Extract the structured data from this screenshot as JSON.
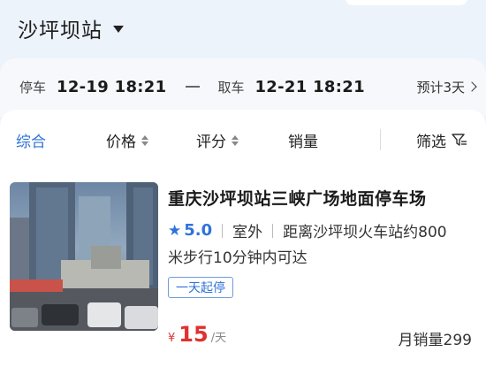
{
  "location": {
    "title": "沙坪坝站"
  },
  "time": {
    "park_label": "停车",
    "park_value": "12-19 18:21",
    "pickup_label": "取车",
    "pickup_value": "12-21 18:21",
    "estimate": "预计3天"
  },
  "filters": {
    "items": [
      "综合",
      "价格",
      "评分",
      "销量"
    ],
    "filter_label": "筛选"
  },
  "lot": {
    "name": "重庆沙坪坝站三峡广场地面停车场",
    "score": "5.0",
    "type": "室外",
    "distance_line1": "距离沙坪坝火车站约800",
    "distance_line2": "米步行10分钟内可达",
    "tag": "一天起停",
    "currency": "¥",
    "price": "15",
    "price_unit": "/天",
    "sales": "月销量299"
  },
  "colors": {
    "accent": "#2f73d9",
    "price": "#e0302e",
    "background": "#edf3fb"
  }
}
